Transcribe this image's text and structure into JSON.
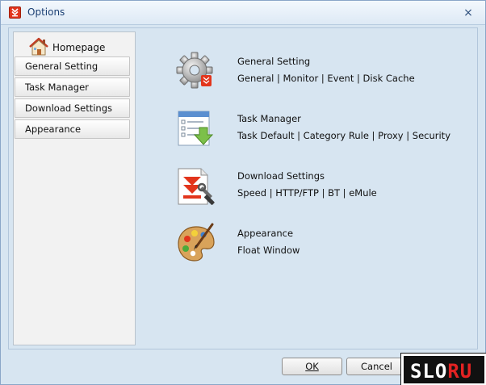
{
  "window": {
    "title": "Options",
    "close_glyph": "×"
  },
  "sidebar": {
    "home_label": "Homepage",
    "items": [
      {
        "label": "General Setting"
      },
      {
        "label": "Task Manager"
      },
      {
        "label": "Download Settings"
      },
      {
        "label": "Appearance"
      }
    ]
  },
  "main": {
    "options": [
      {
        "title": "General Setting",
        "links": "General | Monitor | Event | Disk Cache",
        "icon": "gear-icon"
      },
      {
        "title": "Task Manager",
        "links": "Task Default | Category Rule | Proxy | Security",
        "icon": "task-list-icon"
      },
      {
        "title": "Download Settings",
        "links": "Speed | HTTP/FTP | BT | eMule",
        "icon": "download-tools-icon"
      },
      {
        "title": "Appearance",
        "links": "Float Window",
        "icon": "palette-icon"
      }
    ]
  },
  "footer": {
    "ok_label": "OK",
    "cancel_label": "Cancel"
  },
  "watermark": {
    "text_part1": "SLO",
    "text_part2": "RU"
  },
  "colors": {
    "accent": "#e2351c",
    "background": "#d7e5f1"
  }
}
